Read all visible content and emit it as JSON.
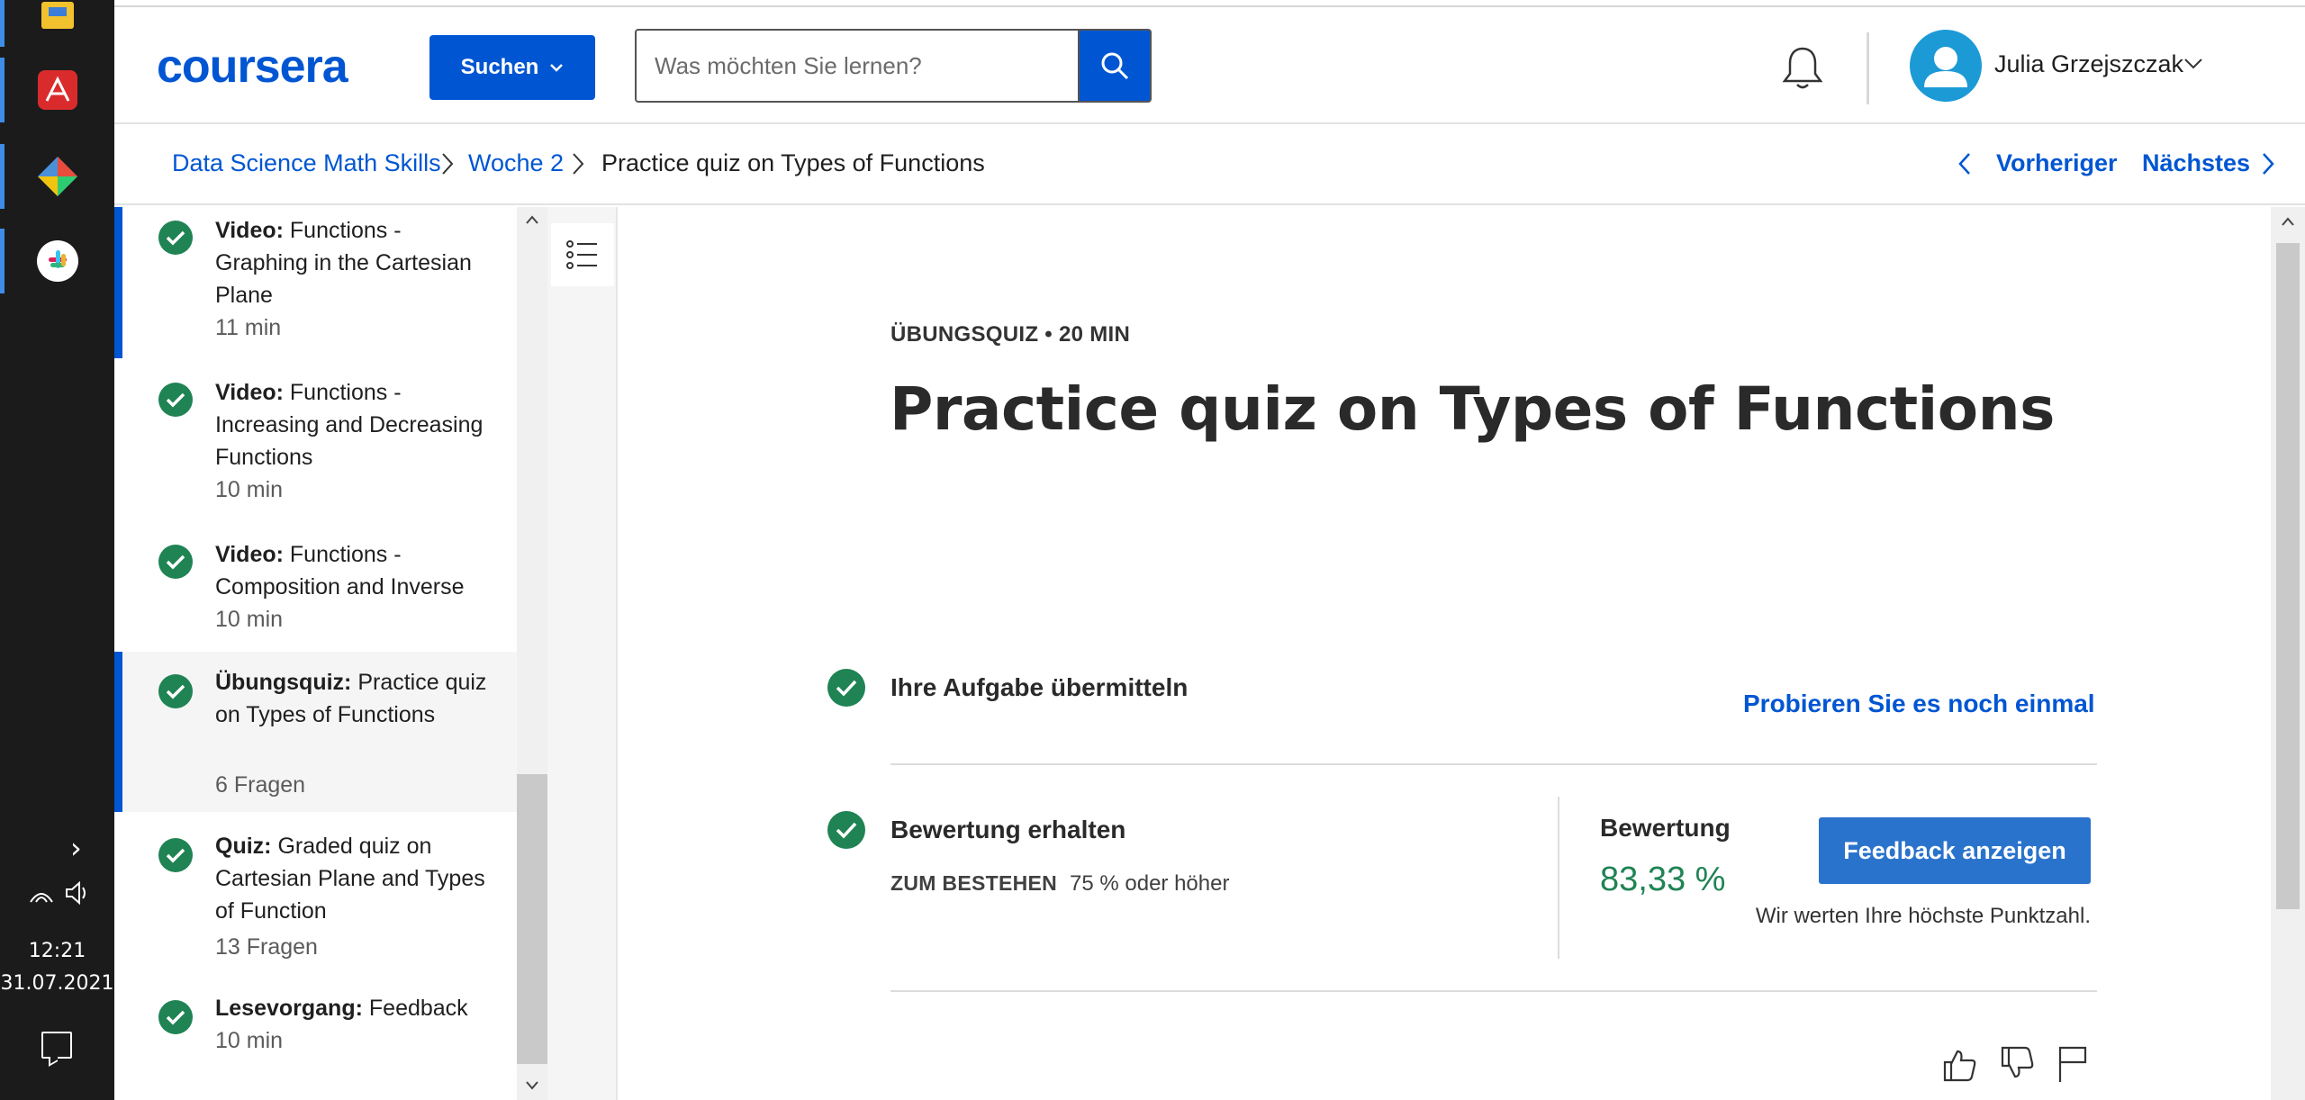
{
  "taskbar": {
    "apps": [
      {
        "name": "file-explorer",
        "color": "#f2c12e"
      },
      {
        "name": "acrobat",
        "color": "#d92b2b"
      },
      {
        "name": "git-app",
        "color": "#ffffff"
      },
      {
        "name": "slack",
        "color": "#ffffff"
      }
    ],
    "clock_time": "12:21",
    "clock_date": "31.07.2021"
  },
  "header": {
    "logo": "coursera",
    "search_button_label": "Suchen",
    "search_placeholder": "Was möchten Sie lernen?",
    "user_name": "Julia Grzejszczak"
  },
  "breadcrumb": {
    "items": [
      "Data Science Math Skills",
      "Woche 2",
      "Practice quiz on Types of Functions"
    ],
    "prev_label": "Vorheriger",
    "next_label": "Nächstes"
  },
  "sidebar": {
    "items": [
      {
        "type": "Video:",
        "title": "Functions - Graphing in the Cartesian Plane",
        "meta": "11 min"
      },
      {
        "type": "Video:",
        "title": "Functions - Increasing and Decreasing Functions",
        "meta": "10 min"
      },
      {
        "type": "Video:",
        "title": "Functions - Composition and Inverse",
        "meta": "10 min"
      },
      {
        "type": "Übungsquiz:",
        "title": "Practice quiz on Types of Functions",
        "meta": "6 Fragen"
      },
      {
        "type": "Quiz:",
        "title": "Graded quiz on Cartesian Plane and Types of Function",
        "meta": "13 Fragen"
      },
      {
        "type": "Lesevorgang:",
        "title": "Feedback",
        "meta": "10 min"
      }
    ]
  },
  "main": {
    "eyebrow": "ÜBUNGSQUIZ • 20 MIN",
    "title": "Practice quiz on Types of Functions",
    "step1_title": "Ihre Aufgabe übermitteln",
    "retry_label": "Probieren Sie es noch einmal",
    "step2_title": "Bewertung erhalten",
    "pass_label": "ZUM BESTEHEN",
    "pass_value": "75 % oder höher",
    "grade_label": "Bewertung",
    "grade_value": "83,33 %",
    "feedback_button": "Feedback anzeigen",
    "grade_note": "Wir werten Ihre höchste Punktzahl."
  },
  "colors": {
    "brand": "#0056d2",
    "success": "#1f8354",
    "check": "#1f8354"
  }
}
